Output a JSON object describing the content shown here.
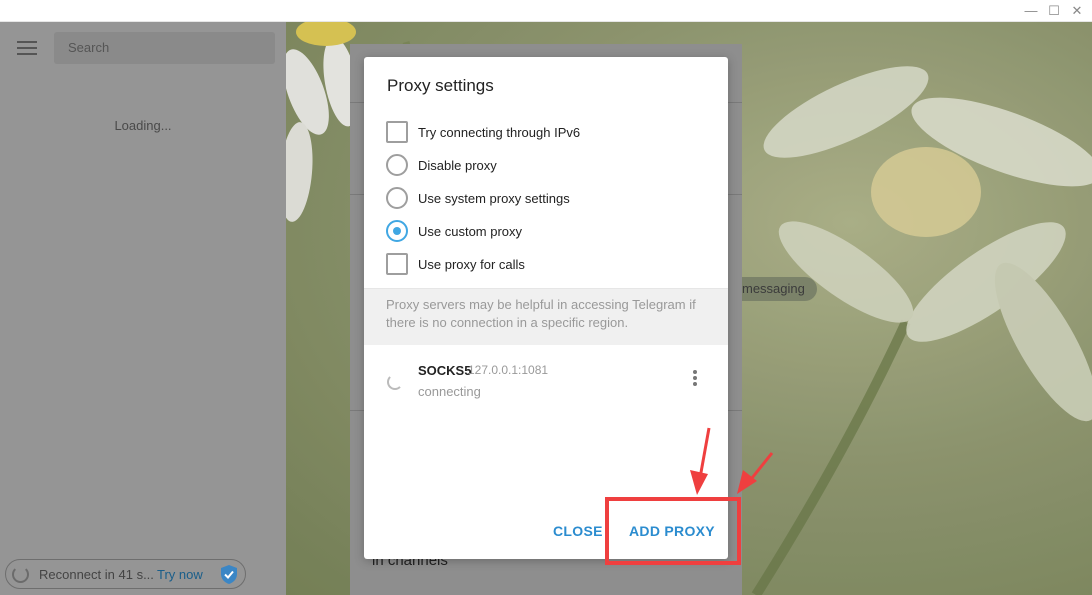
{
  "window": {
    "controls": {
      "minimize": "—",
      "maximize": "☐",
      "close": "✕"
    }
  },
  "sidebar": {
    "search_placeholder": "Search",
    "loading_text": "Loading...",
    "status": {
      "text": "Reconnect in 41 s...",
      "action": "Try now"
    }
  },
  "background": {
    "pill_text": "messaging",
    "channels_text": "in channels"
  },
  "dialog": {
    "title": "Proxy settings",
    "options": [
      {
        "type": "checkbox",
        "label": "Try connecting through IPv6",
        "checked": false
      },
      {
        "type": "radio",
        "label": "Disable proxy",
        "checked": false
      },
      {
        "type": "radio",
        "label": "Use system proxy settings",
        "checked": false
      },
      {
        "type": "radio",
        "label": "Use custom proxy",
        "checked": true
      },
      {
        "type": "checkbox",
        "label": "Use proxy for calls",
        "checked": false
      }
    ],
    "info_text": "Proxy servers may be helpful in accessing Telegram if there is no connection in a specific region.",
    "proxy": {
      "type": "SOCKS5",
      "address": "127.0.0.1:1081",
      "status": "connecting"
    },
    "buttons": {
      "close": "CLOSE",
      "add": "ADD PROXY"
    }
  },
  "colors": {
    "accent": "#40a7e3",
    "button": "#2b8ccf",
    "annotation": "#ef3f3f"
  }
}
